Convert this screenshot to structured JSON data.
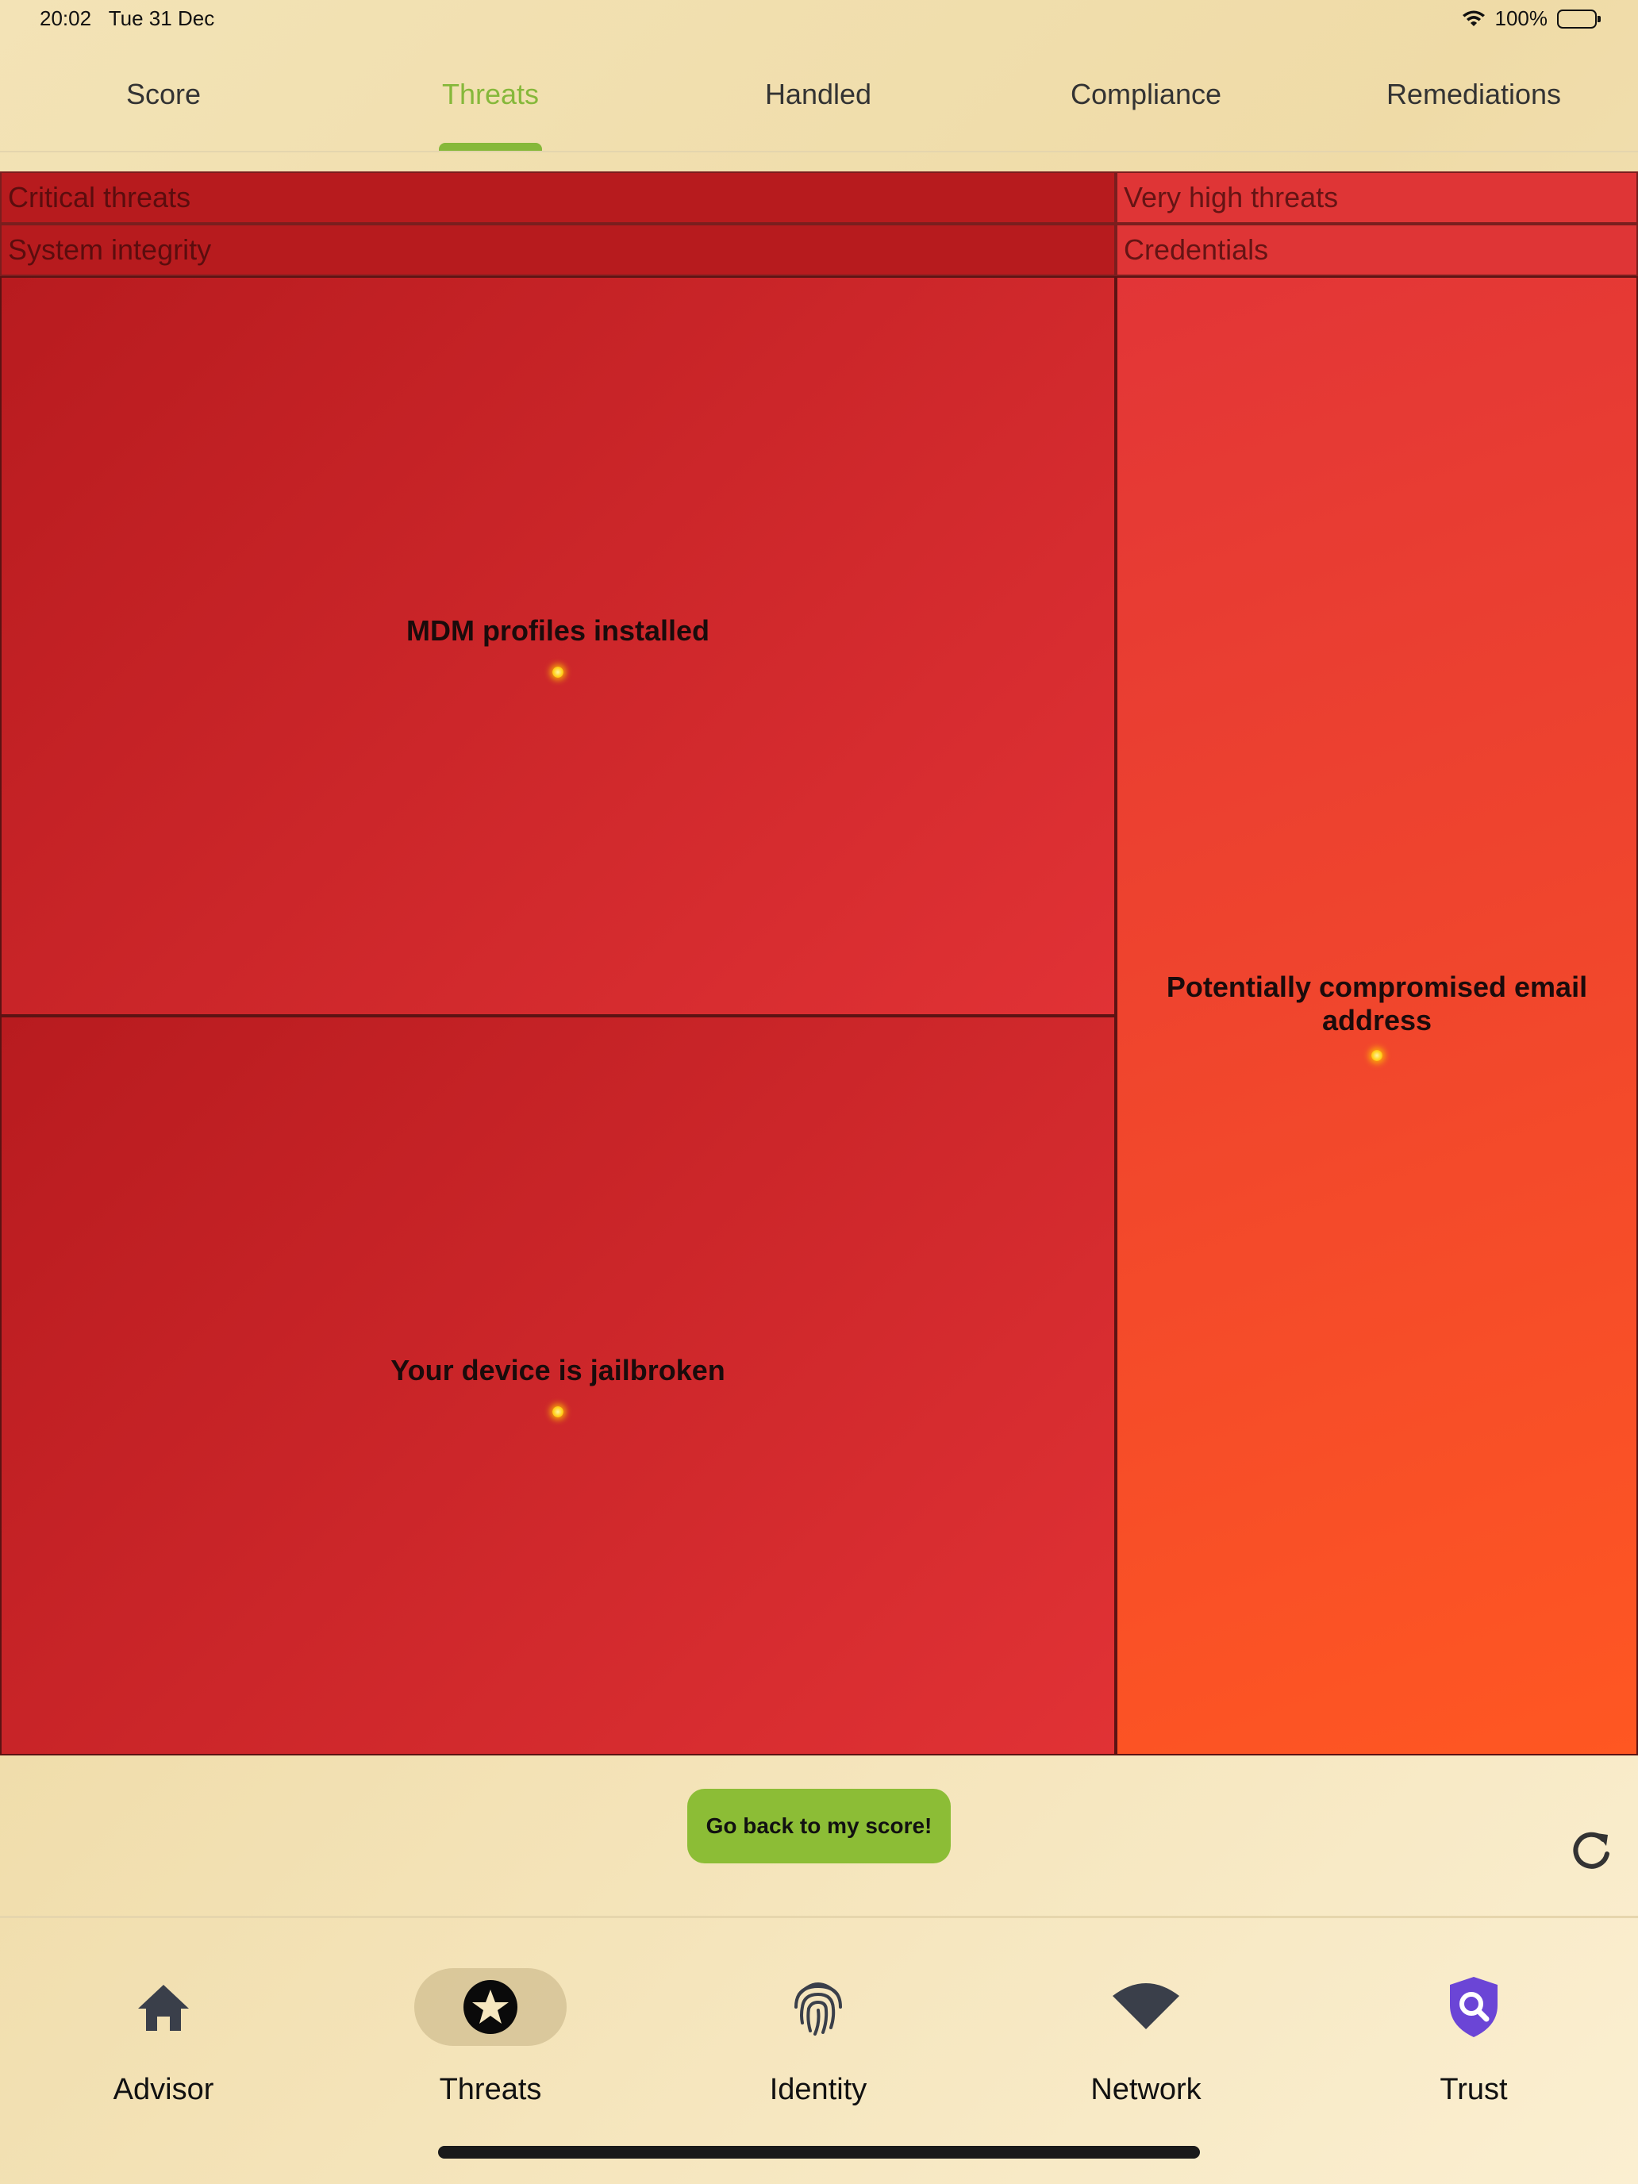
{
  "status_bar": {
    "time": "20:02",
    "date": "Tue 31 Dec",
    "battery": "100%"
  },
  "tabs": [
    {
      "label": "Score",
      "active": false
    },
    {
      "label": "Threats",
      "active": true
    },
    {
      "label": "Handled",
      "active": false
    },
    {
      "label": "Compliance",
      "active": false
    },
    {
      "label": "Remediations",
      "active": false
    }
  ],
  "treemap": {
    "critical": {
      "header": "Critical threats",
      "subheader": "System integrity",
      "items": [
        "MDM profiles installed",
        "Your device is jailbroken"
      ]
    },
    "very_high": {
      "header": "Very high threats",
      "subheader": "Credentials",
      "items": [
        "Potentially compromised email address"
      ]
    },
    "colors": {
      "critical": "#b71b1e",
      "very_high": "#df3536",
      "very_high_end": "#ff5722"
    }
  },
  "actions": {
    "back_button": "Go back to my score!"
  },
  "nav": [
    {
      "label": "Advisor",
      "icon": "home-icon",
      "active": false
    },
    {
      "label": "Threats",
      "icon": "star-badge-icon",
      "active": true
    },
    {
      "label": "Identity",
      "icon": "fingerprint-icon",
      "active": false
    },
    {
      "label": "Network",
      "icon": "wifi-icon",
      "active": false
    },
    {
      "label": "Trust",
      "icon": "shield-search-icon",
      "active": false
    }
  ],
  "colors": {
    "accent": "#86b83a",
    "trust_icon": "#6b45d6"
  }
}
